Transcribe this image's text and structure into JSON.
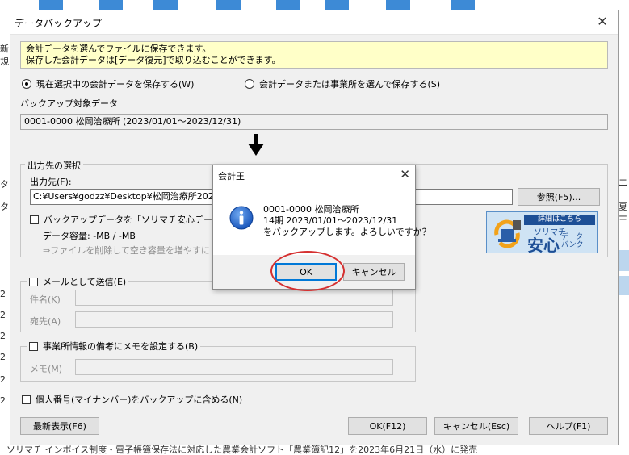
{
  "background": {
    "left_fragments": [
      "新規",
      "タ",
      "タ",
      "2",
      "2",
      "2",
      "2",
      "2",
      "2"
    ],
    "right_fragments": [
      "エ",
      "夏王"
    ],
    "bottom_text": "ソリマチ インボイス制度・電子帳簿保存法に対応した農業会計ソフト「農業簿記12」を2023年6月21日（水）に発売"
  },
  "dialog": {
    "title": "データバックアップ",
    "close": "✕",
    "info_line1": "会計データを選んでファイルに保存できます。",
    "info_line2": "保存した会計データは[データ復元]で取り込むことができます。",
    "radio_current": "現在選択中の会計データを保存する(W)",
    "radio_select": "会計データまたは事業所を選んで保存する(S)",
    "target_label": "バックアップ対象データ",
    "target_value": "0001-0000 松岡治療所 (2023/01/01～2023/12/31)",
    "output_group": "出力先の選択",
    "output_label": "出力先(F):",
    "output_path": "C:¥Users¥godzz¥Desktop¥松岡治療所2023年",
    "browse": "参照(F5)...",
    "bank_check": "バックアップデータを「ソリマチ安心データ",
    "capacity": "データ容量:  -MB / -MB",
    "capacity_hint": "⇒ファイルを削除して空き容量を増やすに",
    "mail_check": "メールとして送信(E)",
    "subject_label": "件名(K)",
    "to_label": "宛先(A)",
    "memo_check": "事業所情報の備考にメモを設定する(B)",
    "memo_label": "メモ(M)",
    "mynumber_check": "個人番号(マイナンバー)をバックアップに含める(N)",
    "refresh": "最新表示(F6)",
    "ok": "OK(F12)",
    "cancel": "キャンセル(Esc)",
    "help": "ヘルプ(F1)"
  },
  "banner": {
    "tag": "詳細はこちら",
    "brand": "ソリマチ",
    "main": "安心",
    "sub1": "データ",
    "sub2": "バンク"
  },
  "popup": {
    "title": "会計王",
    "close": "✕",
    "line1": "0001-0000 松岡治療所",
    "line2": "14期 2023/01/01～2023/12/31",
    "line3": "をバックアップします。よろしいですか？",
    "ok": "OK",
    "cancel": "キャンセル"
  }
}
